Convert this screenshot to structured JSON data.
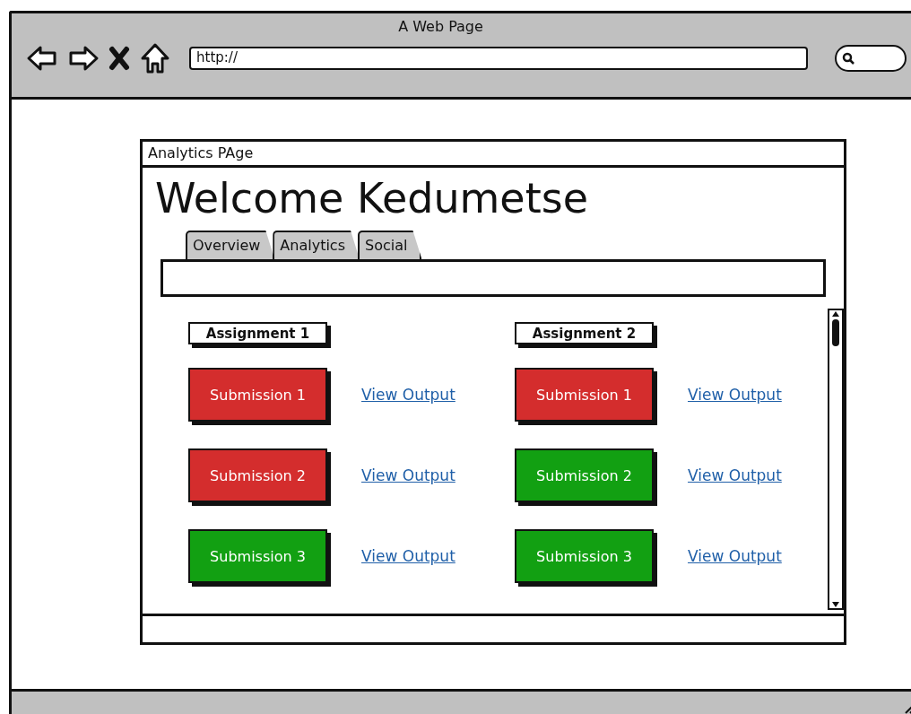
{
  "browser": {
    "title": "A Web Page",
    "url": "http://"
  },
  "window": {
    "title": "Analytics PAge"
  },
  "heading": "Welcome Kedumetse",
  "tabs": [
    {
      "label": "Overview",
      "selected": false
    },
    {
      "label": "Analytics",
      "selected": false
    },
    {
      "label": "Social",
      "selected": false
    }
  ],
  "assignments": [
    {
      "title": "Assignment 1",
      "submissions": [
        {
          "label": "Submission 1",
          "color": "#d42d2d",
          "link": "View Output"
        },
        {
          "label": "Submission 2",
          "color": "#d42d2d",
          "link": "View Output"
        },
        {
          "label": "Submission 3",
          "color": "#12a012",
          "link": "View Output"
        }
      ]
    },
    {
      "title": "Assignment 2",
      "submissions": [
        {
          "label": "Submission 1",
          "color": "#d42d2d",
          "link": "View Output"
        },
        {
          "label": "Submission 2",
          "color": "#12a012",
          "link": "View Output"
        },
        {
          "label": "Submission 3",
          "color": "#12a012",
          "link": "View Output"
        }
      ]
    }
  ]
}
